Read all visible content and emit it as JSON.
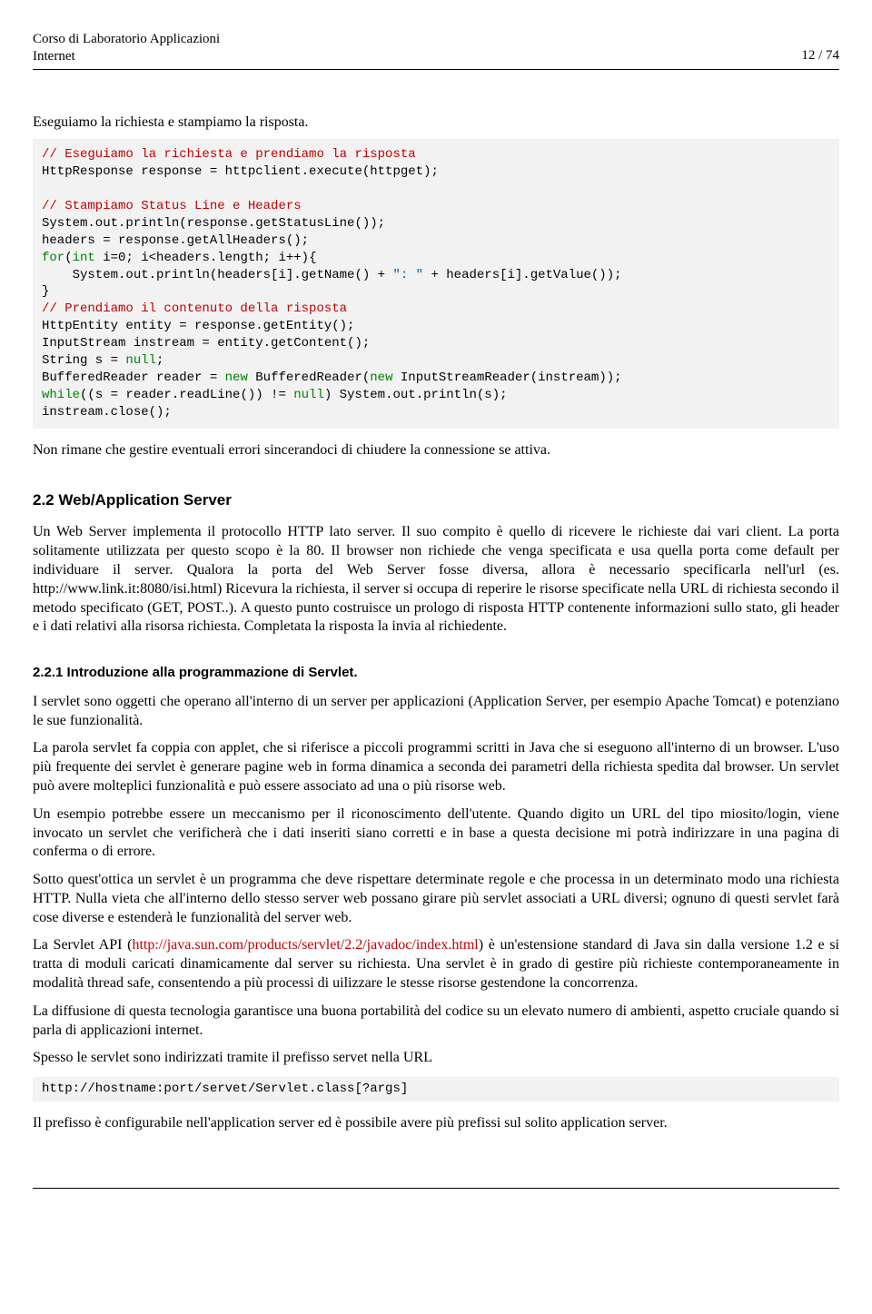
{
  "header": {
    "line1": "Corso di Laboratorio Applicazioni",
    "line2": "Internet",
    "page": "12 / 74"
  },
  "intro1": "Eseguiamo la richiesta e stampiamo la risposta.",
  "code1": {
    "c1": "// Eseguiamo la richiesta e prendiamo la risposta",
    "l2": "HttpResponse response = httpclient.execute(httpget);",
    "blank1": "",
    "c2": "// Stampiamo Status Line e Headers",
    "l4": "System.out.println(response.getStatusLine());",
    "l5": "headers = response.getAllHeaders();",
    "l6a": "for",
    "l6b": "(",
    "l6c": "int",
    "l6d": " i=0; i<headers.length; i++){",
    "l7a": "    System.out.println(headers[i].getName() + ",
    "l7b": "\": \"",
    "l7c": " + headers[i].getValue());",
    "l8": "}",
    "c3": "// Prendiamo il contenuto della risposta",
    "l10": "HttpEntity entity = response.getEntity();",
    "l11": "InputStream instream = entity.getContent();",
    "l12a": "String s = ",
    "l12b": "null",
    "l12c": ";",
    "l13a": "BufferedReader reader = ",
    "l13b": "new",
    "l13c": " BufferedReader(",
    "l13d": "new",
    "l13e": " InputStreamReader(instream));",
    "l14a": "while",
    "l14b": "((s = reader.readLine()) != ",
    "l14c": "null",
    "l14d": ") System.out.println(s);",
    "l15": "instream.close();"
  },
  "after_code1": "Non rimane che gestire eventuali errori sincerandoci di chiudere la connessione se attiva.",
  "sec22_title": "2.2    Web/Application Server",
  "sec22_p1": "Un Web Server implementa il protocollo HTTP lato server. Il suo compito è quello di ricevere le richieste dai vari client. La porta solitamente utilizzata per questo scopo è la 80. Il browser non richiede che venga specificata e usa quella porta come default per individuare il server. Qualora la porta del Web Server fosse diversa, allora è necessario specificarla nell'url (es. http://www.link.it:8080/isi.html) Ricevura la richiesta, il server si occupa di reperire le risorse specificate nella URL di richiesta secondo il metodo specificato (GET, POST..). A questo punto costruisce un prologo di risposta HTTP contenente informazioni sullo stato, gli header e i dati relativi alla risorsa richiesta. Completata la risposta la invia al richiedente.",
  "sec221_title": "2.2.1    Introduzione alla programmazione di Servlet.",
  "sec221_p1": "I servlet sono oggetti che operano all'interno di un server per applicazioni (Application Server, per esempio Apache Tomcat) e potenziano le sue funzionalità.",
  "sec221_p2": "La parola servlet fa coppia con applet, che si riferisce a piccoli programmi scritti in Java che si eseguono all'interno di un browser. L'uso più frequente dei servlet è generare pagine web in forma dinamica a seconda dei parametri della richiesta spedita dal browser. Un servlet può avere molteplici funzionalità e può essere associato ad una o più risorse web.",
  "sec221_p3": "Un esempio potrebbe essere un meccanismo per il riconoscimento dell'utente. Quando digito un URL del tipo miosito/login, viene invocato un servlet che verificherà che i dati inseriti siano corretti e in base a questa decisione mi potrà indirizzare in una pagina di conferma o di errore.",
  "sec221_p4": "Sotto quest'ottica un servlet è un programma che deve rispettare determinate regole e che processa in un determinato modo una richiesta HTTP. Nulla vieta che all'interno dello stesso server web possano girare più servlet associati a URL diversi; ognuno di questi servlet farà cose diverse e estenderà le funzionalità del server web.",
  "sec221_p5a": "La Servlet API (",
  "sec221_link": "http://java.sun.com/products/servlet/2.2/javadoc/index.html",
  "sec221_p5b": ") è un'estensione standard di Java sin dalla versione 1.2 e si tratta di moduli caricati dinamicamente dal server su richiesta. Una servlet è in grado di gestire più richieste contemporaneamente in modalità thread safe, consentendo a più processi di uilizzare le stesse risorse gestendone la concorrenza.",
  "sec221_p6": "La diffusione di questa tecnologia garantisce una buona portabilità del codice su un elevato numero di ambienti, aspetto cruciale quando si parla di applicazioni internet.",
  "sec221_p7": "Spesso le servlet sono indirizzati tramite il prefisso servet nella URL",
  "code2": "http://hostname:port/servet/Servlet.class[?args]",
  "sec221_p8": "Il prefisso è configurabile nell'application server ed è possibile avere più prefissi sul solito application server."
}
